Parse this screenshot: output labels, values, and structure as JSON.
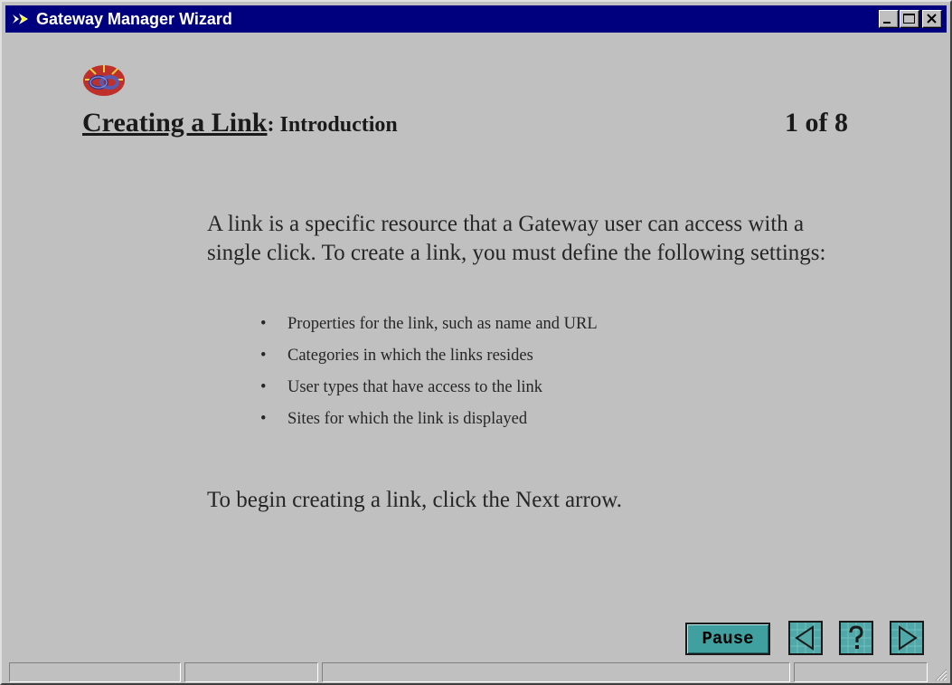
{
  "window": {
    "title": "Gateway Manager Wizard",
    "title_bar_color": "#00007f",
    "controls": [
      "minimize",
      "maximize",
      "close"
    ]
  },
  "content": {
    "topic": "Creating a Link",
    "subtitle": ": Introduction",
    "page_indicator": "1 of 8",
    "intro": "A link is a specific resource that a Gateway user can access with a single click. To create a link, you must define the following settings:",
    "bullets": [
      "Properties for the link, such as name and URL",
      "Categories in which the links resides",
      "User types that have access to the link",
      "Sites for which the link is displayed"
    ],
    "closing": "To begin creating a link, click the Next arrow."
  },
  "controls": {
    "pause_label": "Pause",
    "prev_icon": "left-arrow-icon",
    "help_icon": "question-mark-icon",
    "next_icon": "right-arrow-icon",
    "accent_color": "#40a0a0"
  },
  "statusbar": {
    "panes": [
      "",
      "",
      "",
      ""
    ]
  }
}
